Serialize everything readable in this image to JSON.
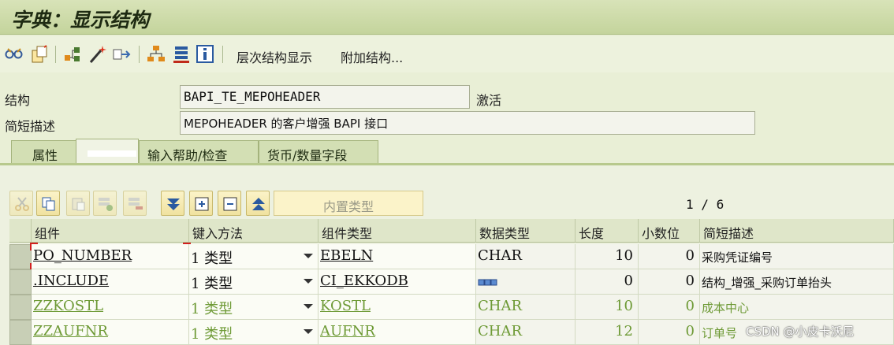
{
  "window": {
    "title": "字典：显示结构"
  },
  "toolbar": {
    "icons": [
      "glasses-icon",
      "copy-object-icon",
      "hierarchy-icon",
      "magic-wand-icon",
      "transport-icon",
      "org-chart-icon",
      "stack-icon",
      "info-icon"
    ],
    "hierarchy_label": "层次结构显示",
    "append_label": "附加结构..."
  },
  "form": {
    "structure_label": "结构",
    "structure_value": "BAPI_TE_MEPOHEADER",
    "status": "激活",
    "desc_label": "简短描述",
    "desc_value": "MEPOHEADER 的客户增强 BAPI 接口"
  },
  "tabs": [
    {
      "label": "属性",
      "active": false
    },
    {
      "label": "",
      "active": true
    },
    {
      "label": "输入帮助/检查",
      "active": false
    },
    {
      "label": "货币/数量字段",
      "active": false
    }
  ],
  "table_toolbar": {
    "builtin_type_label": "内置类型",
    "page_current": "1",
    "page_sep": "/",
    "page_total": "6"
  },
  "columns": [
    "组件",
    "键入方法",
    "组件类型",
    "数据类型",
    "长度",
    "小数位",
    "简短描述"
  ],
  "rows": [
    {
      "component": "PO_NUMBER",
      "method": "1 类型",
      "comp_type": "EBELN",
      "data_type": "CHAR",
      "length": "10",
      "decimals": "0",
      "desc": "采购凭证编号",
      "green": false
    },
    {
      "component": ".INCLUDE",
      "method": "1 类型",
      "comp_type": "CI_EKKODB",
      "data_type": "",
      "length": "0",
      "decimals": "0",
      "desc": "结构_增强_采购订单抬头",
      "green": false
    },
    {
      "component": "ZZKOSTL",
      "method": "1 类型",
      "comp_type": "KOSTL",
      "data_type": "CHAR",
      "length": "10",
      "decimals": "0",
      "desc": "成本中心",
      "green": true
    },
    {
      "component": "ZZAUFNR",
      "method": "1 类型",
      "comp_type": "AUFNR",
      "data_type": "CHAR",
      "length": "12",
      "decimals": "0",
      "desc": "订单号",
      "green": true
    }
  ],
  "watermark": "CSDN @小皮卡沃尼"
}
